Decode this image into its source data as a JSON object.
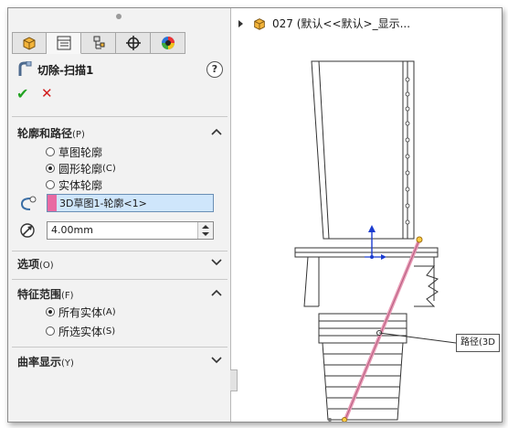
{
  "feature": {
    "title": "切除-扫描1",
    "help_icon": "?",
    "ok_symbol": "✔",
    "cancel_symbol": "✕"
  },
  "tabs": [
    {
      "name": "feature-manager",
      "icon": "cube-icon"
    },
    {
      "name": "property-manager",
      "icon": "property-list-icon"
    },
    {
      "name": "configuration-manager",
      "icon": "config-icon"
    },
    {
      "name": "dimxpert-manager",
      "icon": "crosshair-icon"
    },
    {
      "name": "display-manager",
      "icon": "color-wheel-icon"
    }
  ],
  "sections": {
    "profile_path": {
      "title": "轮廓和路径",
      "key": "(P)",
      "options": [
        {
          "label": "草图轮廓",
          "key": "",
          "selected": false
        },
        {
          "label": "圆形轮廓",
          "key": "(C)",
          "selected": true
        },
        {
          "label": "实体轮廓",
          "key": "",
          "selected": false
        }
      ],
      "path_value": "3D草图1-轮廓<1>",
      "diameter_value": "4.00mm"
    },
    "options": {
      "title": "选项",
      "key": "(O)"
    },
    "feature_scope": {
      "title": "特征范围",
      "key": "(F)",
      "options": [
        {
          "label": "所有实体",
          "key": "(A)",
          "selected": true
        },
        {
          "label": "所选实体",
          "key": "(S)",
          "selected": false
        }
      ]
    },
    "curvature": {
      "title": "曲率显示",
      "key": "(Y)"
    }
  },
  "tree": {
    "label": "027  (默认<<默认>_显示..."
  },
  "viewport": {
    "path_label": "路径(3D"
  },
  "colors": {
    "profile_pink": "#e86aa3",
    "path_line": "#e99ab5",
    "selection_blue": "#cfe6fb",
    "ok_green": "#23a323",
    "cancel_red": "#d21e1e",
    "triad_blue": "#1b3ccf"
  }
}
